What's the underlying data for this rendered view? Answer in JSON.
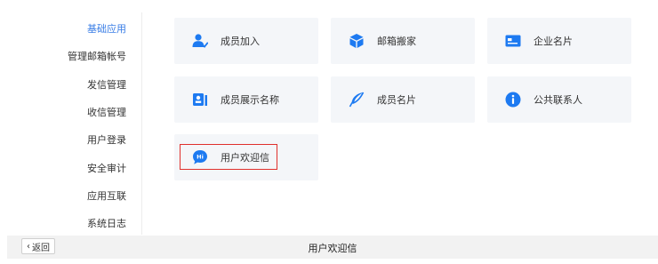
{
  "sidebar": {
    "items": [
      {
        "label": "基础应用",
        "active": true
      },
      {
        "label": "管理邮箱帐号"
      },
      {
        "label": "发信管理"
      },
      {
        "label": "收信管理"
      },
      {
        "label": "用户登录"
      },
      {
        "label": "安全审计"
      },
      {
        "label": "应用互联"
      },
      {
        "label": "系统日志"
      }
    ]
  },
  "tiles": [
    {
      "label": "成员加入",
      "icon": "add-member-icon"
    },
    {
      "label": "邮箱搬家",
      "icon": "box-icon"
    },
    {
      "label": "企业名片",
      "icon": "card-icon"
    },
    {
      "label": "成员展示名称",
      "icon": "name-card-icon"
    },
    {
      "label": "成员名片",
      "icon": "feather-icon"
    },
    {
      "label": "公共联系人",
      "icon": "info-icon"
    },
    {
      "label": "用户欢迎信",
      "icon": "hi-chat-icon",
      "highlighted": true
    }
  ],
  "footer": {
    "back_label": "返回",
    "title": "用户欢迎信"
  },
  "colors": {
    "accent": "#3a7ee6",
    "icon": "#1d7af1",
    "tile_bg": "#f4f6f9",
    "highlight": "#e0302c"
  }
}
